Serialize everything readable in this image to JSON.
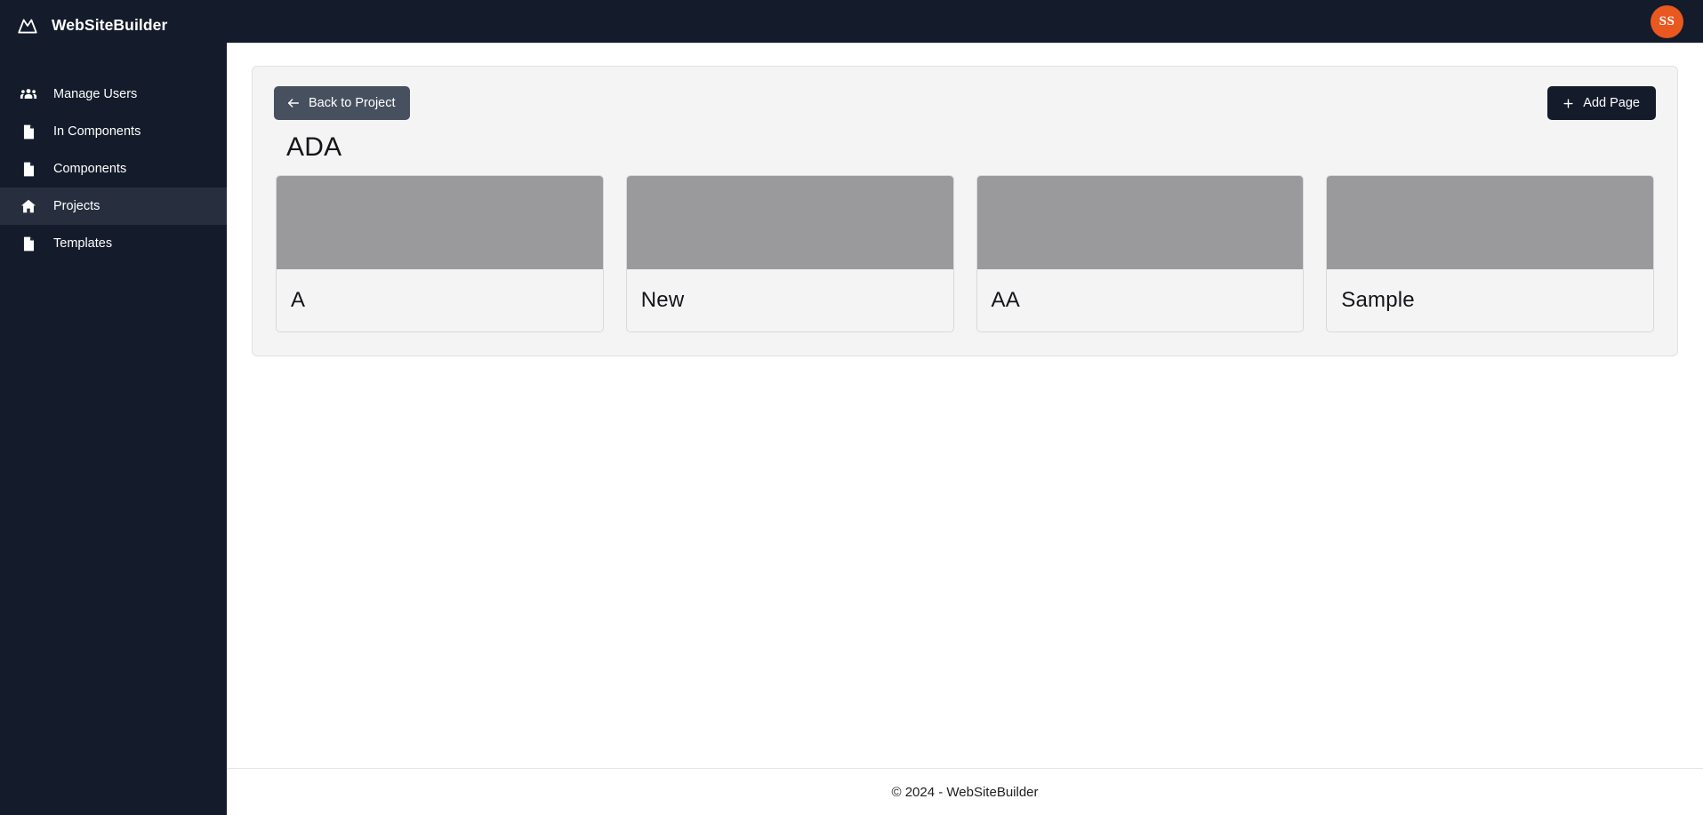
{
  "sidebar": {
    "brand": {
      "name": "WebSiteBuilder",
      "logo_icon": "mountain-logo-icon"
    },
    "items": [
      {
        "label": "Manage Users",
        "icon": "users-group-icon",
        "active": false
      },
      {
        "label": "In Components",
        "icon": "file-icon",
        "active": false
      },
      {
        "label": "Components",
        "icon": "file-icon",
        "active": false
      },
      {
        "label": "Projects",
        "icon": "home-icon",
        "active": true
      },
      {
        "label": "Templates",
        "icon": "file-icon",
        "active": false
      }
    ]
  },
  "topbar": {
    "avatar_initials": "SS",
    "avatar_color": "#e8581f"
  },
  "main": {
    "back_button": {
      "label": "Back to Project",
      "icon": "arrow-left-icon"
    },
    "add_button": {
      "label": "Add Page",
      "icon": "plus-icon"
    },
    "project_title": "ADA",
    "cards": [
      {
        "title": "A"
      },
      {
        "title": "New"
      },
      {
        "title": "AA"
      },
      {
        "title": "Sample"
      }
    ]
  },
  "footer": {
    "text": "© 2024 - WebSiteBuilder"
  },
  "colors": {
    "sidebar_bg": "#141b2b",
    "sidebar_active": "#272f3f",
    "panel_bg": "#f4f4f5",
    "thumb_gray": "#9a9a9c",
    "accent": "#e8581f"
  }
}
